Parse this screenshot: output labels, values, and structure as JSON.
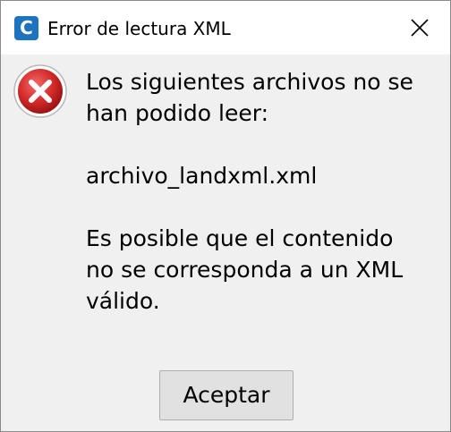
{
  "window": {
    "title": "Error de lectura XML",
    "app_icon_letter": "C"
  },
  "icons": {
    "app": "app-logo-icon",
    "close": "close-icon",
    "error": "error-icon"
  },
  "message": {
    "line1": "Los siguientes archivos no se",
    "line2": "han podido leer:",
    "file_name": "archivo_landxml.xml",
    "line3": "Es posible que el contenido",
    "line4": "no se corresponda a un XML",
    "line5": "válido."
  },
  "buttons": {
    "ok_label": "Aceptar"
  },
  "colors": {
    "app_icon": "#1e73be",
    "error_red": "#c8202a",
    "dialog_background": "#f0f0f0",
    "button_background": "#e1e1e1"
  }
}
